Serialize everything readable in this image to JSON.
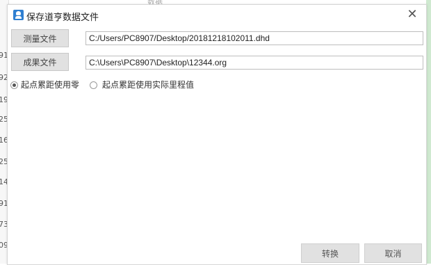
{
  "background": {
    "top_text": "数据",
    "row_numbers": [
      "91",
      "92",
      "19",
      "25",
      "16",
      "25",
      "14",
      "91",
      "73",
      "09"
    ]
  },
  "dialog": {
    "title": "保存道亨数据文件",
    "close_glyph": "✕",
    "measure_file_button": "测量文件",
    "measure_file_path": "C:/Users/PC8907/Desktop/20181218102011.dhd",
    "result_file_button": "成果文件",
    "result_file_path": "C:\\Users\\PC8907\\Desktop\\12344.org",
    "radio_options": [
      {
        "label": "起点累距使用零",
        "checked": true
      },
      {
        "label": "起点累距使用实际里程值",
        "checked": false
      }
    ],
    "convert_button": "转换",
    "cancel_button": "取消"
  }
}
